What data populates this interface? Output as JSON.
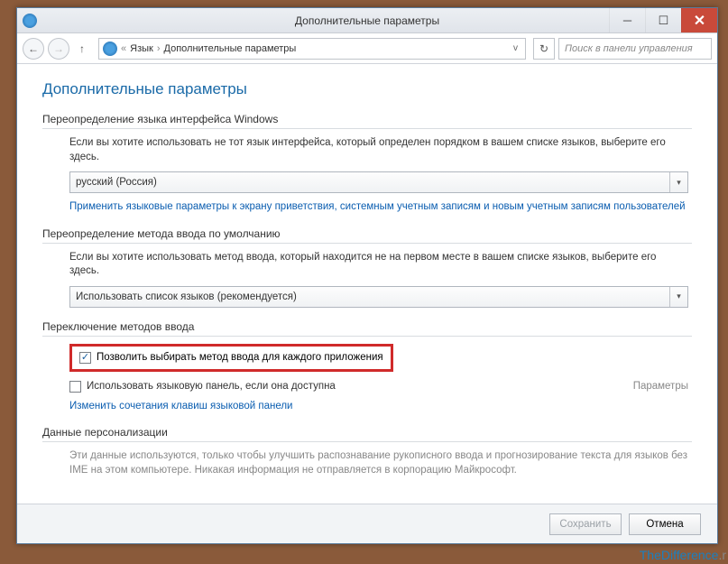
{
  "window": {
    "title": "Дополнительные параметры"
  },
  "nav": {
    "breadcrumb_prefix": "«",
    "breadcrumb_item1": "Язык",
    "breadcrumb_item2": "Дополнительные параметры",
    "search_placeholder": "Поиск в панели управления"
  },
  "page": {
    "heading": "Дополнительные параметры"
  },
  "section1": {
    "title": "Переопределение языка интерфейса Windows",
    "instruction": "Если вы хотите использовать не тот язык интерфейса, который определен порядком в вашем списке языков, выберите его здесь.",
    "dropdown_value": "русский (Россия)",
    "link": "Применить языковые параметры к экрану приветствия, системным учетным записям и новым учетным записям пользователей"
  },
  "section2": {
    "title": "Переопределение метода ввода по умолчанию",
    "instruction": "Если вы хотите использовать метод ввода, который находится не на первом месте в вашем списке языков, выберите его здесь.",
    "dropdown_value": "Использовать список языков (рекомендуется)"
  },
  "section3": {
    "title": "Переключение методов ввода",
    "checkbox1_label": "Позволить выбирать метод ввода для каждого приложения",
    "checkbox2_label": "Использовать языковую панель, если она доступна",
    "params_label": "Параметры",
    "link": "Изменить сочетания клавиш языковой панели"
  },
  "section4": {
    "title": "Данные персонализации",
    "instruction": "Эти данные используются, только чтобы улучшить распознавание рукописного ввода и прогнозирование текста для языков без IME на этом компьютере. Никакая информация не отправляется в корпорацию Майкрософт."
  },
  "buttons": {
    "save": "Сохранить",
    "cancel": "Отмена"
  },
  "watermark": {
    "text": "TheDifference",
    "suffix": ".r"
  }
}
